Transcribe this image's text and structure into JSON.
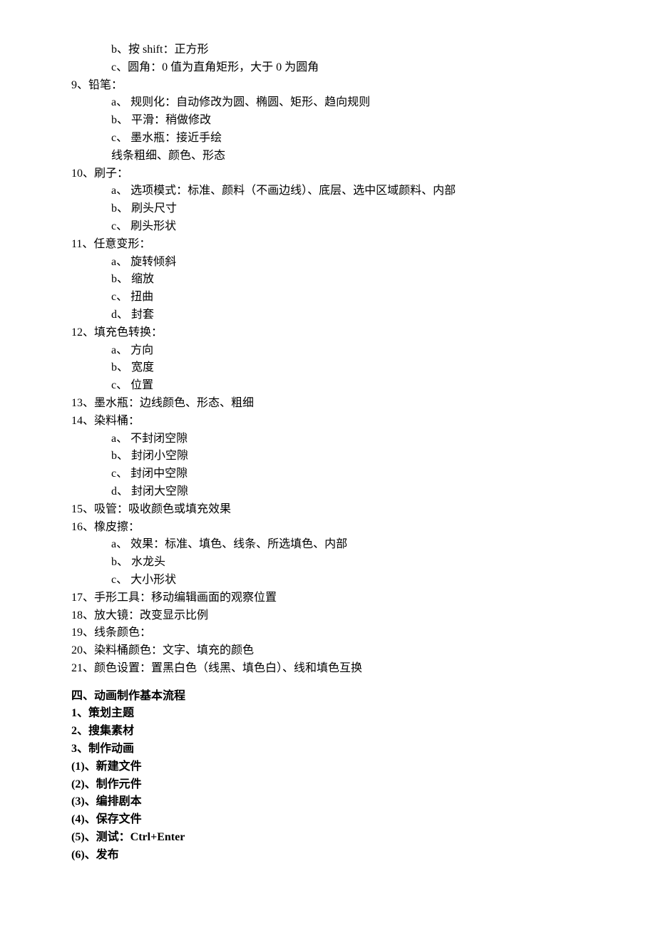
{
  "lines": [
    {
      "cls": "l1",
      "text": "b、按 shift：正方形"
    },
    {
      "cls": "l1",
      "text": "c、圆角：0 值为直角矩形，大于 0 为圆角"
    },
    {
      "cls": "l0",
      "text": "9、铅笔："
    },
    {
      "cls": "l1",
      "text": "a、 规则化：自动修改为圆、椭圆、矩形、趋向规则"
    },
    {
      "cls": "l1",
      "text": "b、 平滑：稍做修改"
    },
    {
      "cls": "l1",
      "text": "c、 墨水瓶：接近手绘"
    },
    {
      "cls": "l1",
      "text": "线条粗细、颜色、形态"
    },
    {
      "cls": "l0",
      "text": "10、刷子："
    },
    {
      "cls": "l1",
      "text": "a、 选项模式：标准、颜料（不画边线）、底层、选中区域颜料、内部"
    },
    {
      "cls": "l1",
      "text": "b、 刷头尺寸"
    },
    {
      "cls": "l1",
      "text": "c、 刷头形状"
    },
    {
      "cls": "l0",
      "text": "11、任意变形："
    },
    {
      "cls": "l1",
      "text": "a、 旋转倾斜"
    },
    {
      "cls": "l1",
      "text": "b、 缩放"
    },
    {
      "cls": "l1",
      "text": "c、 扭曲"
    },
    {
      "cls": "l1",
      "text": "d、 封套"
    },
    {
      "cls": "l0",
      "text": "12、填充色转换："
    },
    {
      "cls": "l1",
      "text": "a、 方向"
    },
    {
      "cls": "l1",
      "text": "b、 宽度"
    },
    {
      "cls": "l1",
      "text": "c、 位置"
    },
    {
      "cls": "l0",
      "text": "13、墨水瓶：边线颜色、形态、粗细"
    },
    {
      "cls": "l0",
      "text": "14、染料桶："
    },
    {
      "cls": "l1",
      "text": "a、 不封闭空隙"
    },
    {
      "cls": "l1",
      "text": "b、 封闭小空隙"
    },
    {
      "cls": "l1",
      "text": "c、 封闭中空隙"
    },
    {
      "cls": "l1",
      "text": "d、 封闭大空隙"
    },
    {
      "cls": "l0",
      "text": "15、吸管：吸收颜色或填充效果"
    },
    {
      "cls": "l0",
      "text": "16、橡皮擦："
    },
    {
      "cls": "l1",
      "text": "a、 效果：标准、填色、线条、所选填色、内部"
    },
    {
      "cls": "l1",
      "text": "b、 水龙头"
    },
    {
      "cls": "l1",
      "text": "c、 大小形状"
    },
    {
      "cls": "l0",
      "text": "17、手形工具：移动编辑画面的观察位置"
    },
    {
      "cls": "l0",
      "text": "18、放大镜：改变显示比例"
    },
    {
      "cls": "l0",
      "text": "19、线条颜色："
    },
    {
      "cls": "l0",
      "text": "20、染料桶颜色：文字、填充的颜色"
    },
    {
      "cls": "l0",
      "text": "21、颜色设置：置黑白色（线黑、填色白）、线和填色互换"
    },
    {
      "cls": "section-break",
      "text": ""
    },
    {
      "cls": "l0 bold",
      "text": "四、动画制作基本流程"
    },
    {
      "cls": "l0 bold",
      "text": "1、策划主题"
    },
    {
      "cls": "l0 bold",
      "text": "2、搜集素材"
    },
    {
      "cls": "l0 bold",
      "text": "3、制作动画"
    },
    {
      "cls": "l0 bold",
      "text": "(1)、新建文件"
    },
    {
      "cls": "l0 bold",
      "text": "(2)、制作元件"
    },
    {
      "cls": "l0 bold",
      "text": "(3)、编排剧本"
    },
    {
      "cls": "l0 bold",
      "text": "(4)、保存文件"
    },
    {
      "cls": "l0 bold",
      "text": "(5)、测试：Ctrl+Enter"
    },
    {
      "cls": "l0 bold",
      "text": "(6)、发布"
    }
  ]
}
